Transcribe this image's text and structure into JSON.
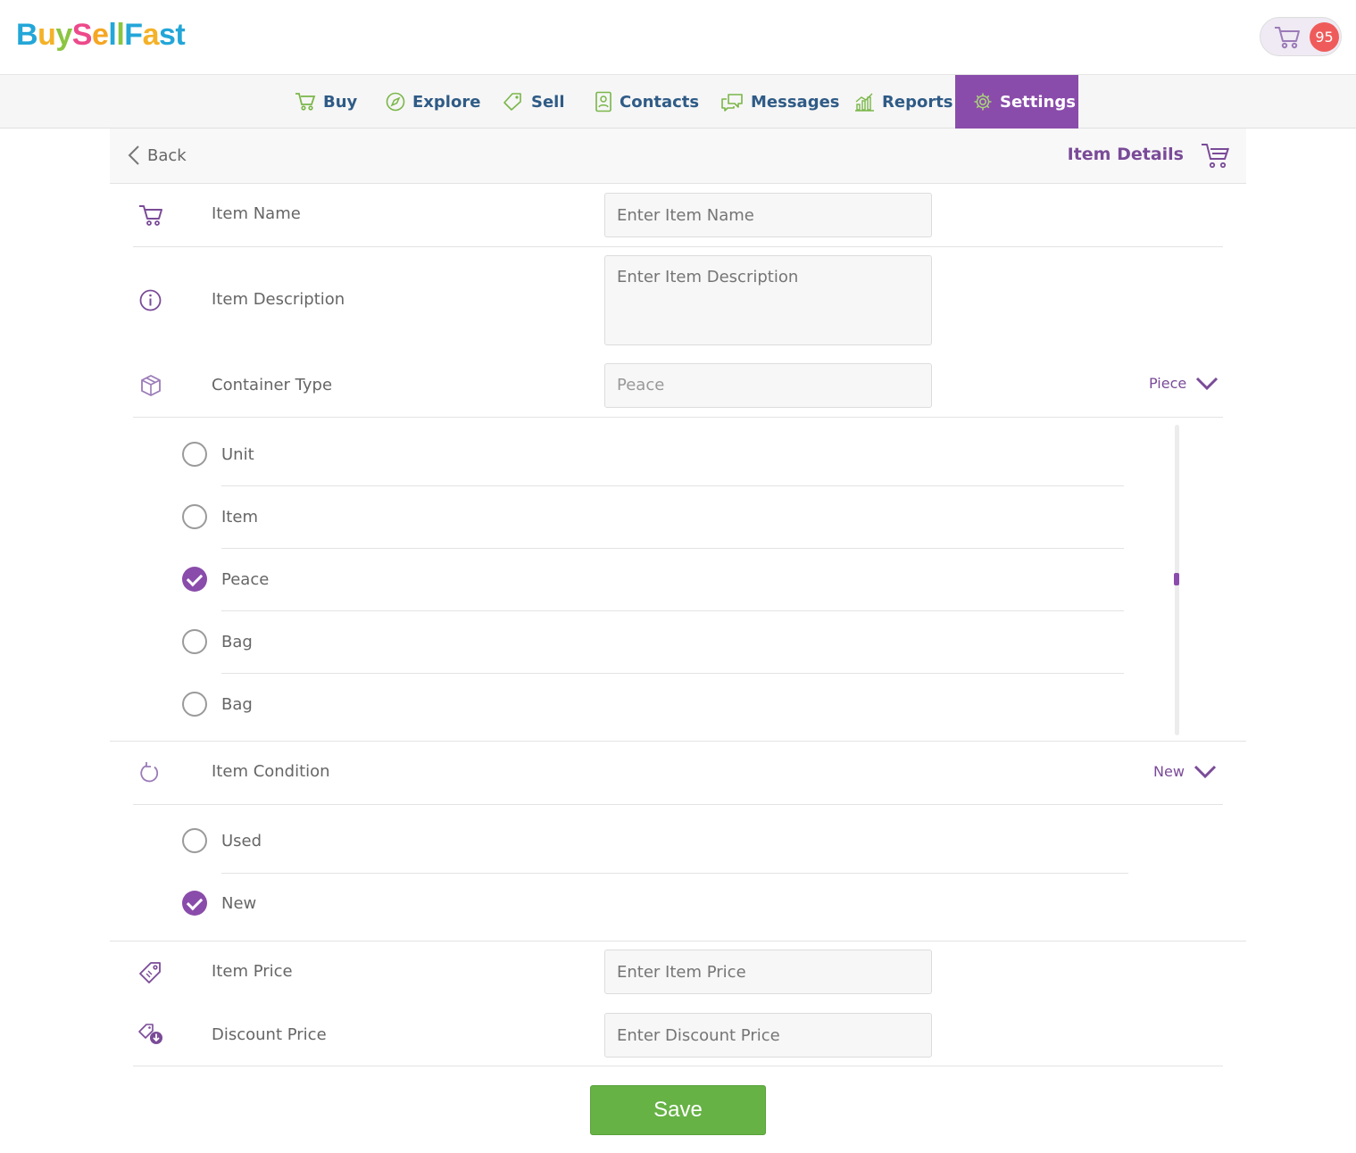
{
  "app": {
    "logo_letters": [
      {
        "ch": "B",
        "color": "#23a6d8"
      },
      {
        "ch": "u",
        "color": "#f4b228"
      },
      {
        "ch": "y",
        "color": "#8bc540"
      },
      {
        "ch": "S",
        "color": "#ed4a8b"
      },
      {
        "ch": "e",
        "color": "#f5a623"
      },
      {
        "ch": "l",
        "color": "#23a6d8"
      },
      {
        "ch": "l",
        "color": "#8bc540"
      },
      {
        "ch": "F",
        "color": "#23a6d8"
      },
      {
        "ch": "a",
        "color": "#f4b228"
      },
      {
        "ch": "s",
        "color": "#23a6d8"
      },
      {
        "ch": "t",
        "color": "#23a6d8"
      }
    ],
    "logo_text": "BuySellFast",
    "cart_count": "95"
  },
  "nav": {
    "items": [
      {
        "label": "Buy",
        "icon": "cart-icon"
      },
      {
        "label": "Explore",
        "icon": "compass-icon"
      },
      {
        "label": "Sell",
        "icon": "tag-icon"
      },
      {
        "label": "Contacts",
        "icon": "contacts-icon"
      },
      {
        "label": "Messages",
        "icon": "messages-icon"
      },
      {
        "label": "Reports",
        "icon": "chart-icon"
      },
      {
        "label": "Settings",
        "icon": "gear-icon",
        "active": true
      }
    ]
  },
  "subheader": {
    "back_label": "Back",
    "title": "Item Details"
  },
  "form": {
    "item_name": {
      "label": "Item Name",
      "placeholder": "Enter Item Name"
    },
    "item_description": {
      "label": "Item Description",
      "placeholder": "Enter Item Description"
    },
    "container_type": {
      "label": "Container Type",
      "value": "Peace",
      "selected_display": "Piece",
      "options": [
        {
          "label": "Unit",
          "checked": false
        },
        {
          "label": "Item",
          "checked": false
        },
        {
          "label": "Peace",
          "checked": true
        },
        {
          "label": "Bag",
          "checked": false
        },
        {
          "label": "Bag",
          "checked": false
        }
      ]
    },
    "item_condition": {
      "label": "Item Condition",
      "selected_display": "New",
      "options": [
        {
          "label": "Used",
          "checked": false
        },
        {
          "label": "New",
          "checked": true
        }
      ]
    },
    "item_price": {
      "label": "Item Price",
      "placeholder": "Enter Item Price"
    },
    "discount_price": {
      "label": "Discount Price",
      "placeholder": "Enter Discount Price"
    },
    "save_label": "Save"
  },
  "colors": {
    "accent": "#8a4cab",
    "nav_text": "#2f5b86",
    "nav_icon": "#7ab648",
    "save": "#66b245",
    "badge": "#ef5b5b"
  }
}
